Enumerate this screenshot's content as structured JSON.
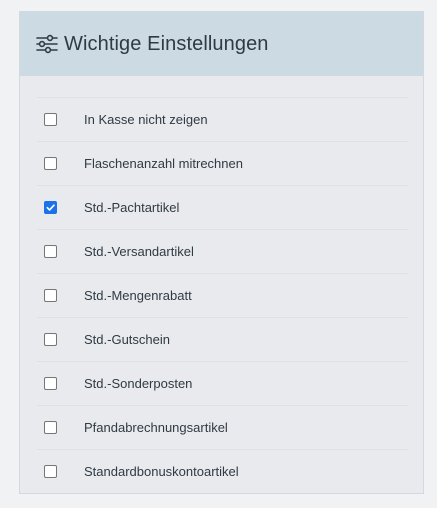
{
  "panel": {
    "title": "Wichtige Einstellungen",
    "icon": "sliders-icon"
  },
  "settings": [
    {
      "label": "In Kasse nicht zeigen",
      "checked": false
    },
    {
      "label": "Flaschenanzahl mitrechnen",
      "checked": false
    },
    {
      "label": "Std.-Pachtartikel",
      "checked": true
    },
    {
      "label": "Std.-Versandartikel",
      "checked": false
    },
    {
      "label": "Std.-Mengenrabatt",
      "checked": false
    },
    {
      "label": "Std.-Gutschein",
      "checked": false
    },
    {
      "label": "Std.-Sonderposten",
      "checked": false
    },
    {
      "label": "Pfandabrechnungsartikel",
      "checked": false
    },
    {
      "label": "Standardbonuskontoartikel",
      "checked": false
    }
  ],
  "colors": {
    "header_bg": "#ccdae3",
    "panel_bg": "#e9eaed",
    "checkbox_checked": "#1a73e8",
    "text": "#2f3a44"
  }
}
